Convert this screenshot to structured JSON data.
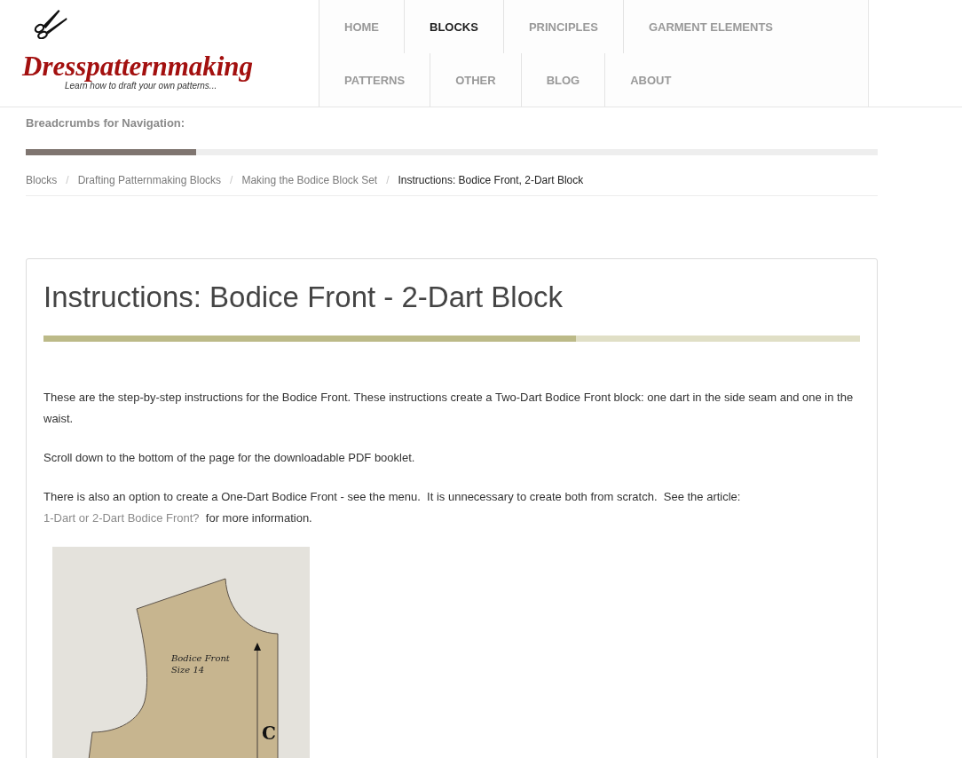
{
  "logo": {
    "name": "Dresspatternmaking",
    "tagline": "Learn how to draft your own patterns..."
  },
  "nav": {
    "items": [
      {
        "label": "HOME",
        "selected": false
      },
      {
        "label": "BLOCKS",
        "selected": true
      },
      {
        "label": "PRINCIPLES",
        "selected": false
      },
      {
        "label": "GARMENT ELEMENTS",
        "selected": false
      },
      {
        "label": "PATTERNS",
        "selected": false
      },
      {
        "label": "OTHER",
        "selected": false
      },
      {
        "label": "BLOG",
        "selected": false
      },
      {
        "label": "ABOUT",
        "selected": false
      }
    ]
  },
  "breadcrumbs": {
    "heading": "Breadcrumbs for Navigation:",
    "progress": {
      "level": 0.2
    },
    "separator": "/",
    "trail": [
      {
        "label": "Blocks",
        "current": false
      },
      {
        "label": "Drafting Patternmaking Blocks",
        "current": false
      },
      {
        "label": "Making the Bodice Block Set",
        "current": false
      },
      {
        "label": "Instructions: Bodice Front, 2-Dart Block",
        "current": true
      }
    ]
  },
  "article": {
    "title": "Instructions: Bodice Front - 2-Dart Block",
    "accent_bar": {
      "level": 0.652
    },
    "paragraphs": [
      {
        "parts": [
          {
            "kind": "text",
            "text": "These are the step-by-step instructions for the Bodice Front. These instructions create a Two-Dart Bodice Front block: one dart in the side seam and one in the waist."
          }
        ]
      },
      {
        "parts": [
          {
            "kind": "text",
            "text": "Scroll down to the bottom of the page for the downloadable PDF booklet."
          }
        ]
      },
      {
        "parts": [
          {
            "kind": "text",
            "text": "There is also an option to create a One-Dart Bodice Front - see the menu.  It is unnecessary to create both from scratch.  See the article: "
          },
          {
            "kind": "link",
            "text": "1-Dart or 2-Dart Bodice Front?"
          },
          {
            "kind": "text",
            "text": "  for more information."
          }
        ]
      }
    ],
    "figure": {
      "piece_name": "Bodice Front",
      "size": "Size 14",
      "edge_letter": "C"
    }
  }
}
